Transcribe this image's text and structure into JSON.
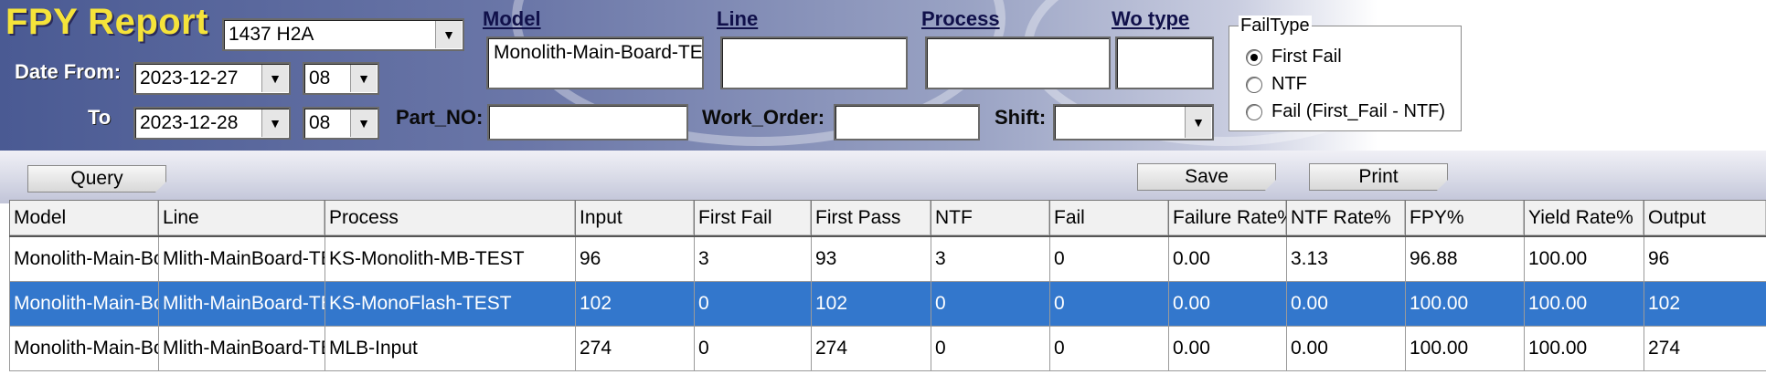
{
  "app": {
    "title": "FPY Report"
  },
  "filters": {
    "site": "1437 H2A",
    "date_from_label": "Date From:",
    "date_from": "2023-12-27",
    "hour_from": "08",
    "to_label": "To",
    "date_to": "2023-12-28",
    "hour_to": "08",
    "model_label": "Model",
    "model_value": "Monolith-Main-Board-TE",
    "line_label": "Line",
    "line_value": "",
    "process_label": "Process",
    "process_value": "",
    "wo_type_label": "Wo type",
    "wo_type_value": "",
    "part_no_label": "Part_NO:",
    "part_no_value": "",
    "work_order_label": "Work_Order:",
    "work_order_value": "",
    "shift_label": "Shift:",
    "shift_value": ""
  },
  "fail_type": {
    "title": "FailType",
    "options": [
      "First Fail",
      "NTF",
      "Fail (First_Fail - NTF)"
    ],
    "selected": "First Fail"
  },
  "toolbar": {
    "query_label": "Query",
    "save_label": "Save",
    "print_label": "Print"
  },
  "table": {
    "columns": [
      "Model",
      "Line",
      "Process",
      "Input",
      "First Fail",
      "First Pass",
      "NTF",
      "Fail",
      "Failure Rate%",
      "NTF Rate%",
      "FPY%",
      "Yield Rate%",
      "Output"
    ],
    "rows": [
      [
        "Monolith-Main-Board-TE",
        "Mlith-MainBoard-TEST",
        "KS-Monolith-MB-TEST",
        "96",
        "3",
        "93",
        "3",
        "0",
        "0.00",
        "3.13",
        "96.88",
        "100.00",
        "96"
      ],
      [
        "Monolith-Main-Board-TE",
        "Mlith-MainBoard-TEST",
        "KS-MonoFlash-TEST",
        "102",
        "0",
        "102",
        "0",
        "0",
        "0.00",
        "0.00",
        "100.00",
        "100.00",
        "102"
      ],
      [
        "Monolith-Main-Board-TE",
        "Mlith-MainBoard-TEST",
        "MLB-Input",
        "274",
        "0",
        "274",
        "0",
        "0",
        "0.00",
        "0.00",
        "100.00",
        "100.00",
        "274"
      ]
    ],
    "selected_row": 1
  }
}
